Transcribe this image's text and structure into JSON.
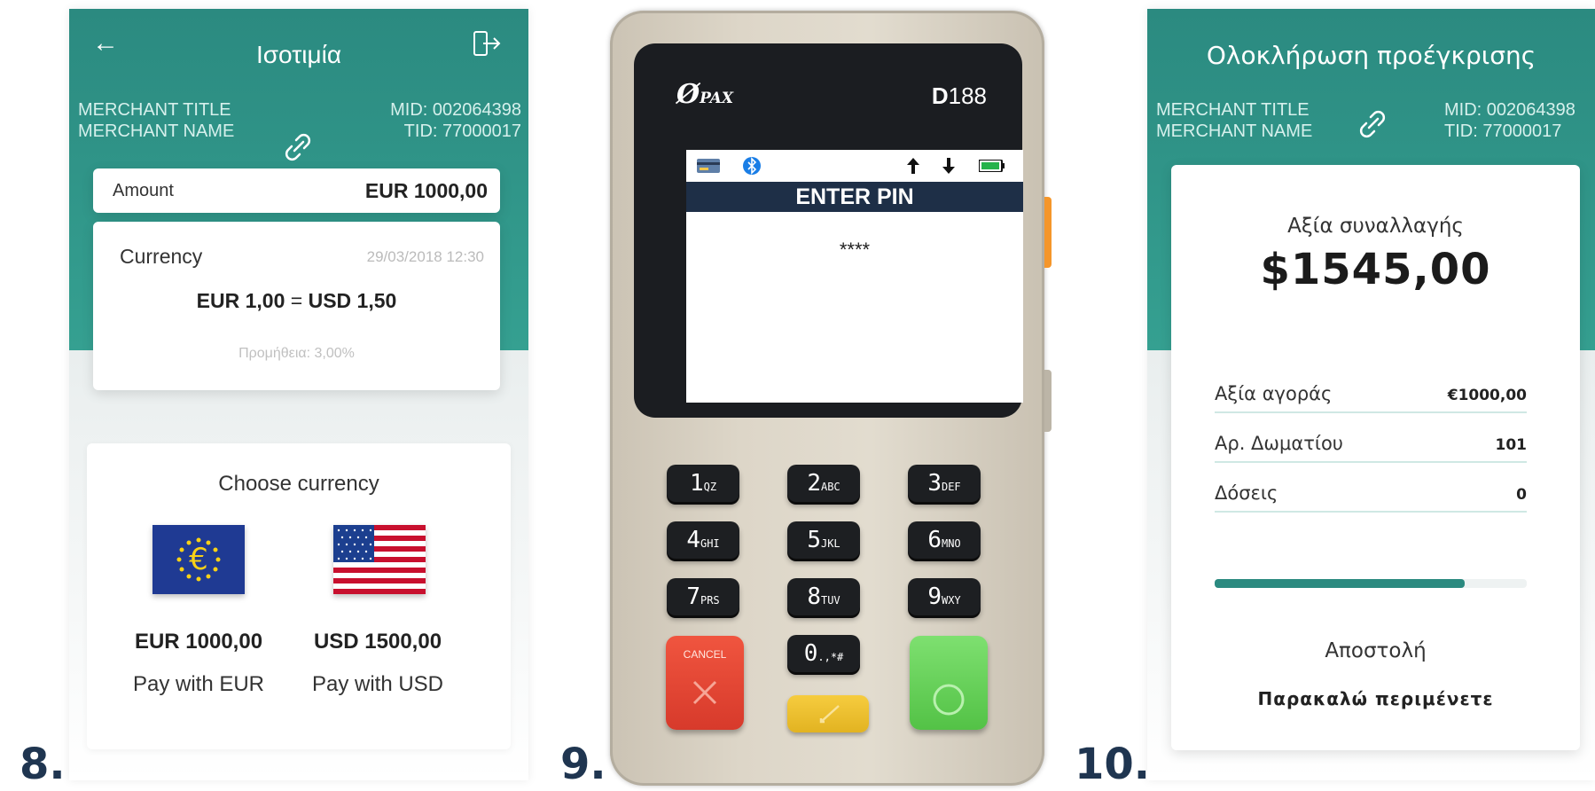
{
  "steps": {
    "s8": "8.",
    "s9": "9.",
    "s10": "10."
  },
  "screen8": {
    "title": "Ισοτιμία",
    "merchant_title": "MERCHANT TITLE",
    "merchant_name": "MERCHANT NAME",
    "mid": "MID: 002064398",
    "tid": "TID: 77000017",
    "amount_label": "Amount",
    "amount_value": "EUR 1000,00",
    "currency_label": "Currency",
    "currency_date": "29/03/2018 12:30",
    "rate_from": "EUR 1,00",
    "rate_eq": "=",
    "rate_to": "USD 1,50",
    "fee": "Προμήθεια: 3,00%",
    "choose_title": "Choose currency",
    "options": [
      {
        "amount": "EUR 1000,00",
        "label": "Pay with EUR",
        "flag": "eu-flag-icon"
      },
      {
        "amount": "USD 1500,00",
        "label": "Pay with USD",
        "flag": "us-flag-icon"
      }
    ]
  },
  "terminal": {
    "brand": "PAX",
    "model_prefix": "D",
    "model_number": "188",
    "screen_title": "ENTER PIN",
    "pin_mask": "****",
    "keys": [
      {
        "digit": "1",
        "letters": "QZ"
      },
      {
        "digit": "2",
        "letters": "ABC"
      },
      {
        "digit": "3",
        "letters": "DEF"
      },
      {
        "digit": "4",
        "letters": "GHI"
      },
      {
        "digit": "5",
        "letters": "JKL"
      },
      {
        "digit": "6",
        "letters": "MNO"
      },
      {
        "digit": "7",
        "letters": "PRS"
      },
      {
        "digit": "8",
        "letters": "TUV"
      },
      {
        "digit": "9",
        "letters": "WXY"
      },
      {
        "digit": "0",
        "letters": ".,*#"
      }
    ],
    "cancel_label": "CANCEL"
  },
  "screen10": {
    "title": "Ολοκλήρωση προέγκρισης",
    "merchant_title": "MERCHANT TITLE",
    "merchant_name": "MERCHANT NAME",
    "mid": "MID: 002064398",
    "tid": "TID: 77000017",
    "value_label": "Αξία συναλλαγής",
    "value_amount": "$1545,00",
    "rows": [
      {
        "label": "Αξία αγοράς",
        "value": "€1000,00"
      },
      {
        "label": "Αρ. Δωματίου",
        "value": "101"
      },
      {
        "label": "Δόσεις",
        "value": "0"
      }
    ],
    "progress": 0.8,
    "send_label": "Αποστολή",
    "wait_label": "Παρακαλώ περιμένετε"
  },
  "colors": {
    "teal": "#2b8a80",
    "navy": "#1f3550",
    "cancel": "#d73a2b",
    "clear": "#e2b321",
    "enter": "#53c246"
  }
}
